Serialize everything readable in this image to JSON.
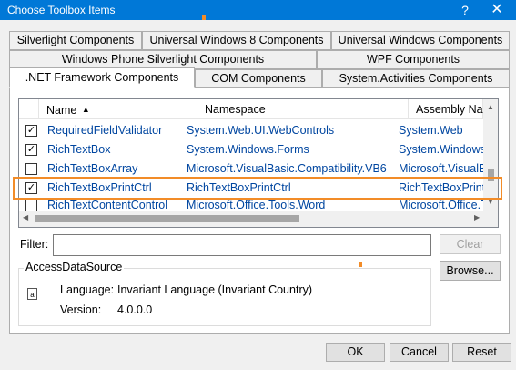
{
  "window": {
    "title": "Choose Toolbox Items",
    "help_glyph": "?",
    "close_glyph": "✕"
  },
  "tabs": {
    "row1": [
      "Silverlight Components",
      "Universal Windows 8 Components",
      "Universal Windows Components"
    ],
    "row2": [
      "Windows Phone Silverlight Components",
      "WPF Components"
    ],
    "row3": [
      ".NET Framework Components",
      "COM Components",
      "System.Activities Components"
    ],
    "active": ".NET Framework Components"
  },
  "grid": {
    "columns": [
      "Name",
      "Namespace",
      "Assembly Name"
    ],
    "sort_glyph": "▲",
    "rows": [
      {
        "checked": true,
        "name": "RequiredFieldValidator",
        "namespace": "System.Web.UI.WebControls",
        "assembly": "System.Web"
      },
      {
        "checked": true,
        "name": "RichTextBox",
        "namespace": "System.Windows.Forms",
        "assembly": "System.Windows."
      },
      {
        "checked": false,
        "name": "RichTextBoxArray",
        "namespace": "Microsoft.VisualBasic.Compatibility.VB6",
        "assembly": "Microsoft.VisualB"
      },
      {
        "checked": true,
        "name": "RichTextBoxPrintCtrl",
        "namespace": "RichTextBoxPrintCtrl",
        "assembly": "RichTextBoxPrint("
      },
      {
        "checked": false,
        "name": "RichTextContentControl",
        "namespace": "Microsoft.Office.Tools.Word",
        "assembly": "Microsoft.Office.T"
      }
    ],
    "highlight_color": "#f28c28"
  },
  "filter": {
    "label": "Filter:",
    "value": "",
    "clear_label": "Clear",
    "browse_label": "Browse..."
  },
  "details": {
    "group_title": "AccessDataSource",
    "language_label": "Language:",
    "language_value": "Invariant Language (Invariant Country)",
    "version_label": "Version:",
    "version_value": "4.0.0.0"
  },
  "footer": {
    "ok_label": "OK",
    "cancel_label": "Cancel",
    "reset_label": "Reset"
  }
}
